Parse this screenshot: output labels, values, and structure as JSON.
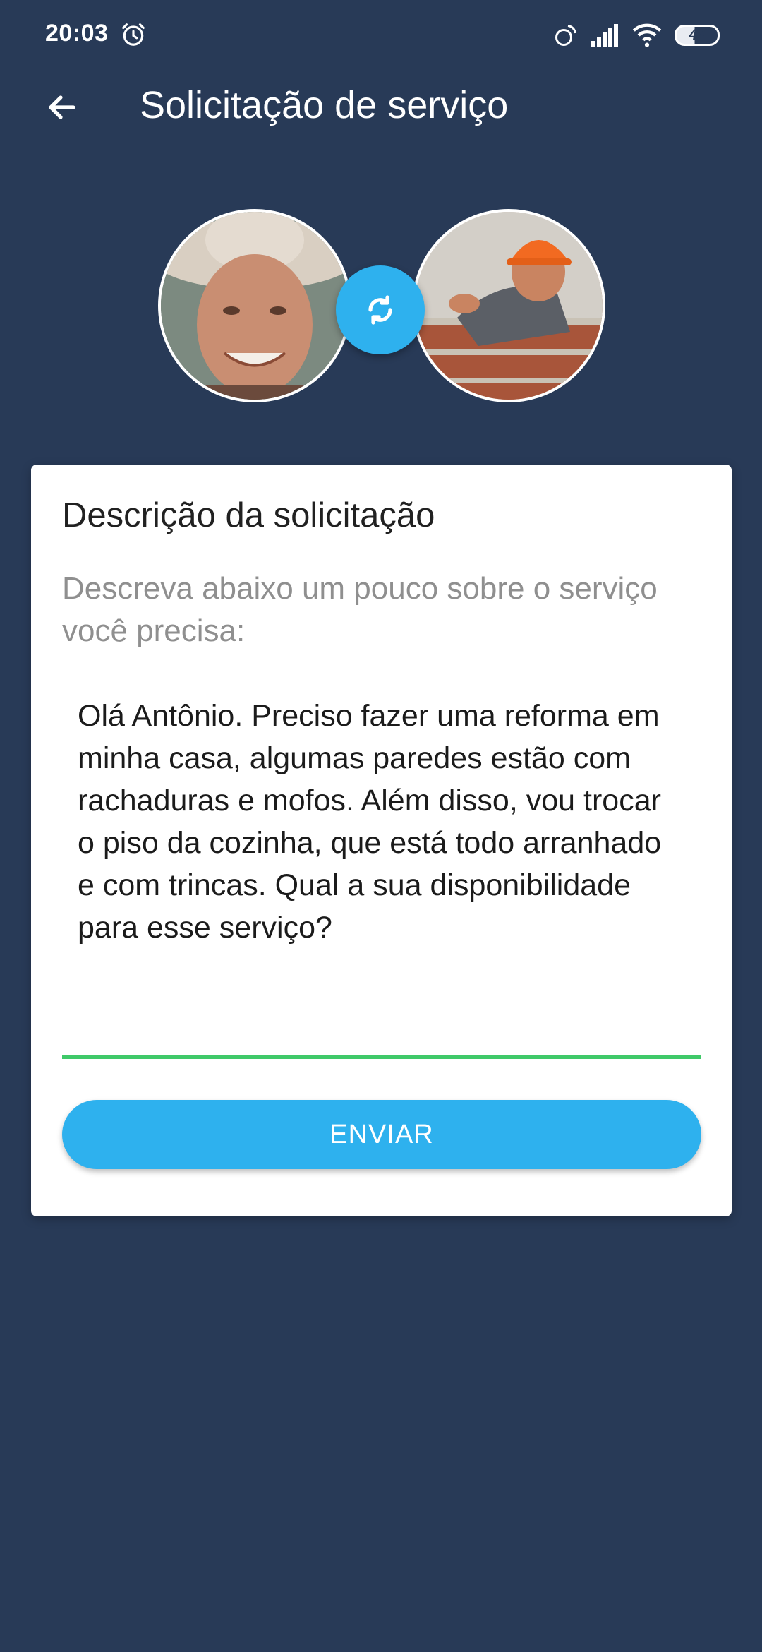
{
  "status_bar": {
    "time": "20:03",
    "battery_level": "44",
    "icons": [
      "alarm-icon",
      "rotation-lock-icon",
      "signal-icon",
      "wifi-icon",
      "battery-icon"
    ]
  },
  "app_bar": {
    "title": "Solicitação de serviço",
    "back_icon": "arrow-back-icon"
  },
  "profiles": {
    "client_avatar": "client-avatar-photo",
    "worker_avatar": "worker-avatar-photo",
    "swap_icon": "sync-icon"
  },
  "request_card": {
    "title": "Descrição da solicitação",
    "subtitle": "Descreva abaixo um pouco sobre o serviço você precisa:",
    "description_value": "Olá Antônio. Preciso fazer uma reforma em minha casa, algumas paredes estão com rachaduras e mofos. Além disso, vou trocar o piso da cozinha, que está todo arranhado e com trincas. Qual a sua disponibilidade para esse serviço?",
    "send_label": "ENVIAR"
  },
  "colors": {
    "background": "#283a57",
    "accent": "#2eb1ee",
    "field_focus": "#3fc969",
    "card": "#ffffff"
  }
}
